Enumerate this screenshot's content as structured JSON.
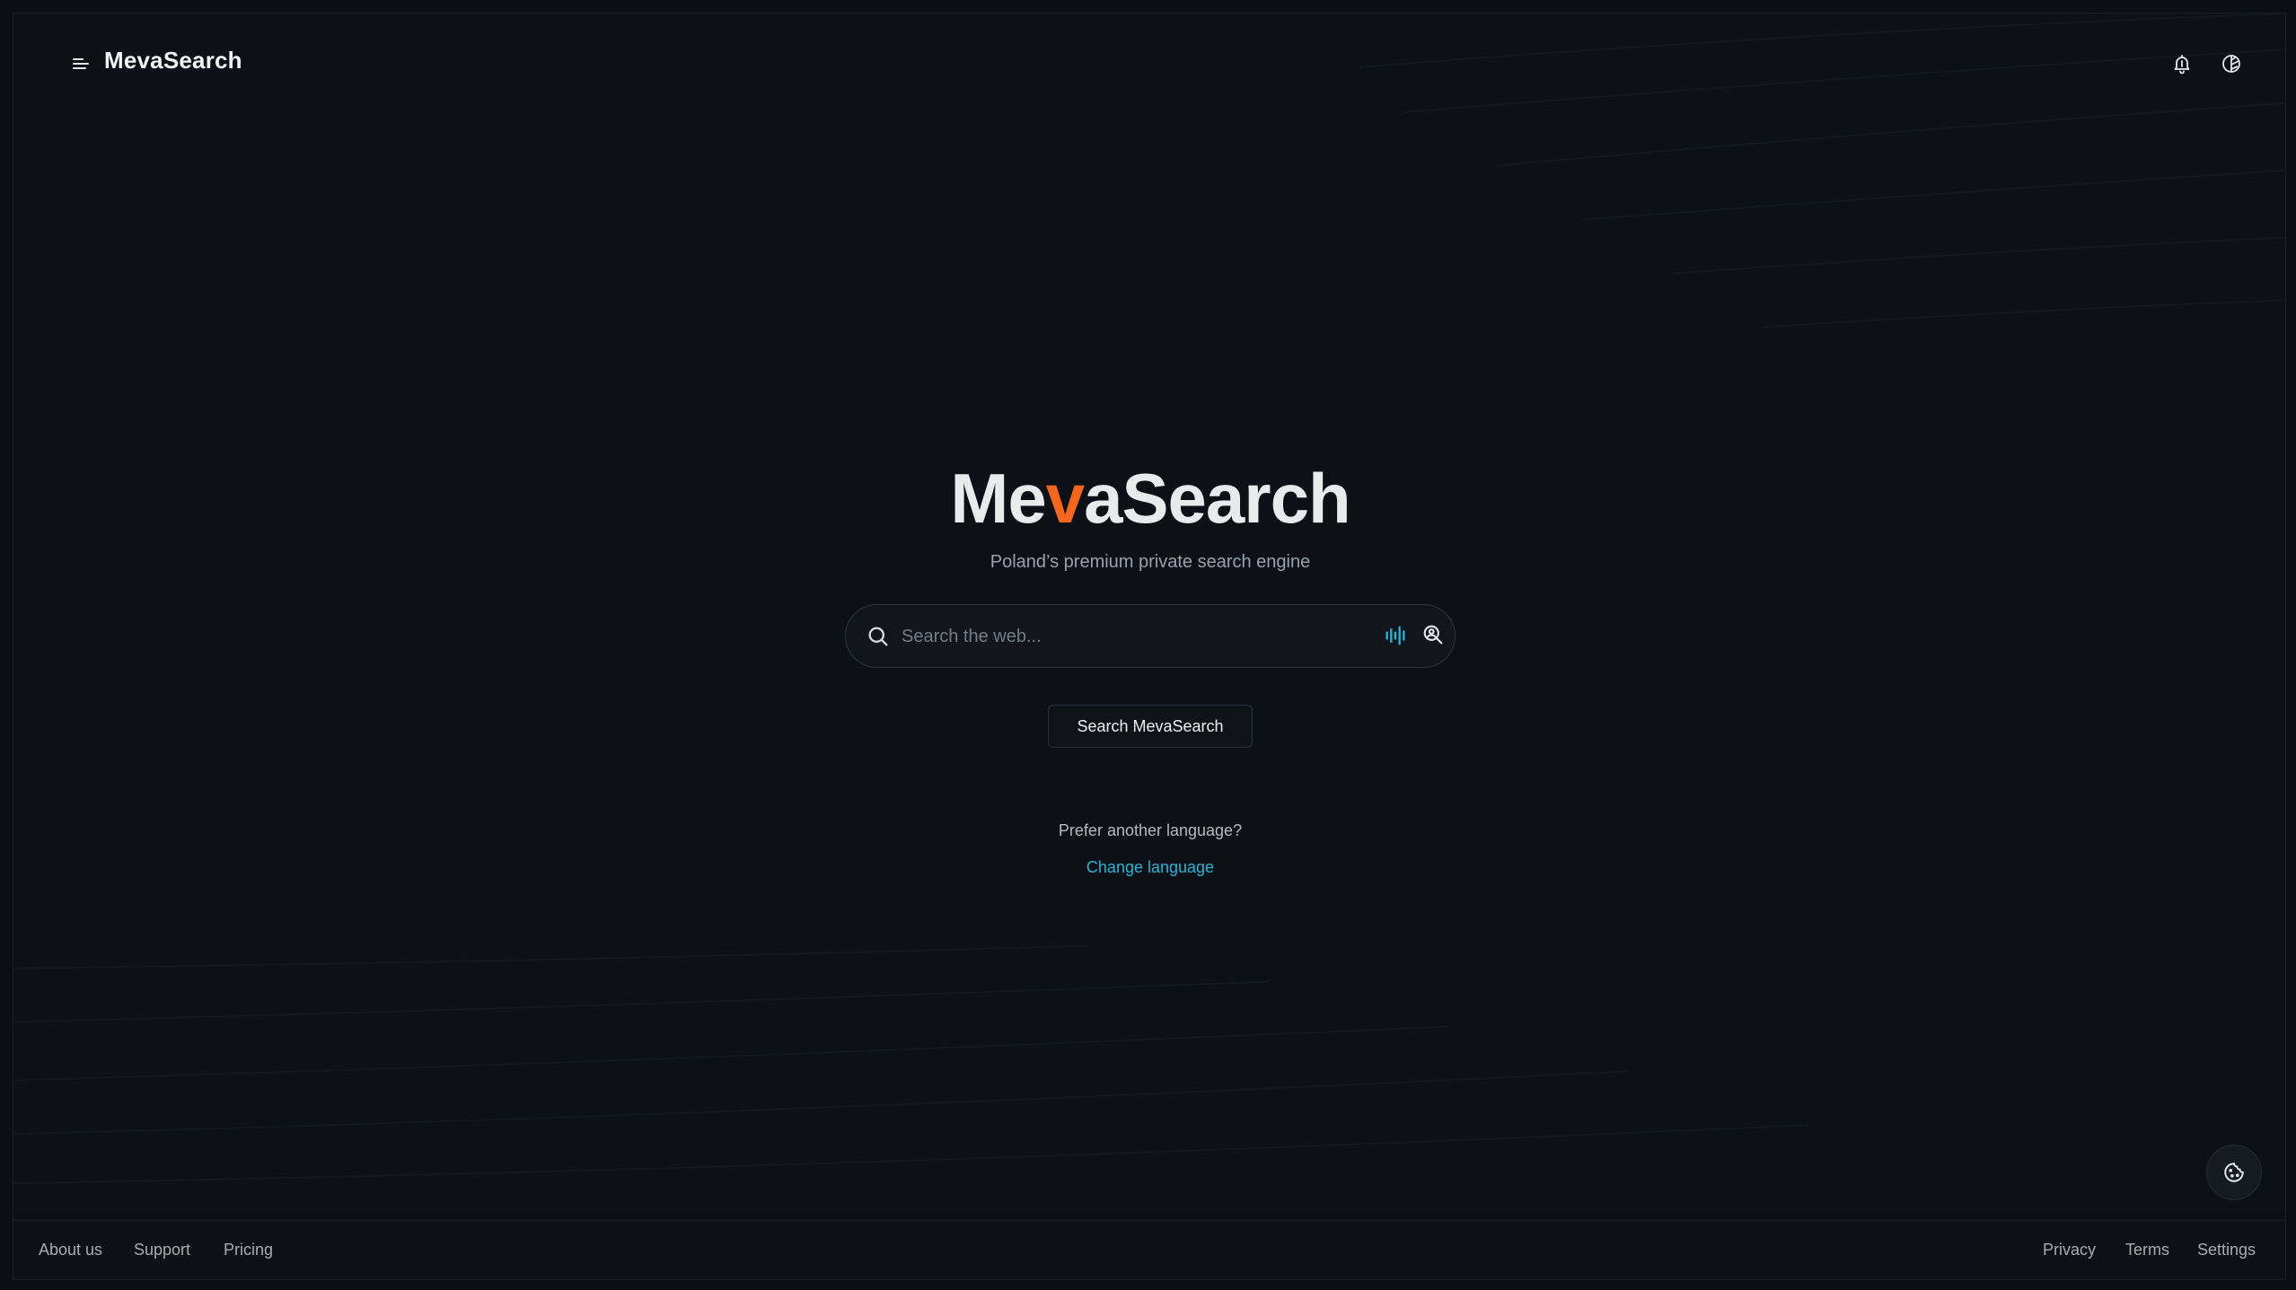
{
  "header": {
    "brand": "MevaSearch",
    "menu_icon": "menu-icon",
    "notification_icon": "bell-icon",
    "theme_icon": "theme-toggle-icon"
  },
  "hero": {
    "title_part1": "Me",
    "title_accent": "v",
    "title_part2": "aSearch",
    "subtitle": "Poland’s premium private search engine"
  },
  "search": {
    "placeholder": "Search the web...",
    "value": "",
    "button_label": "Search MevaSearch"
  },
  "language": {
    "prompt": "Prefer another language?",
    "link": "Change language"
  },
  "footer": {
    "left_links": [
      "About us",
      "Support",
      "Pricing"
    ],
    "right_links": [
      "Privacy",
      "Terms",
      "Settings"
    ]
  },
  "colors": {
    "background": "#0d1117",
    "accent": "#f2661d",
    "link": "#2bb3d3"
  }
}
